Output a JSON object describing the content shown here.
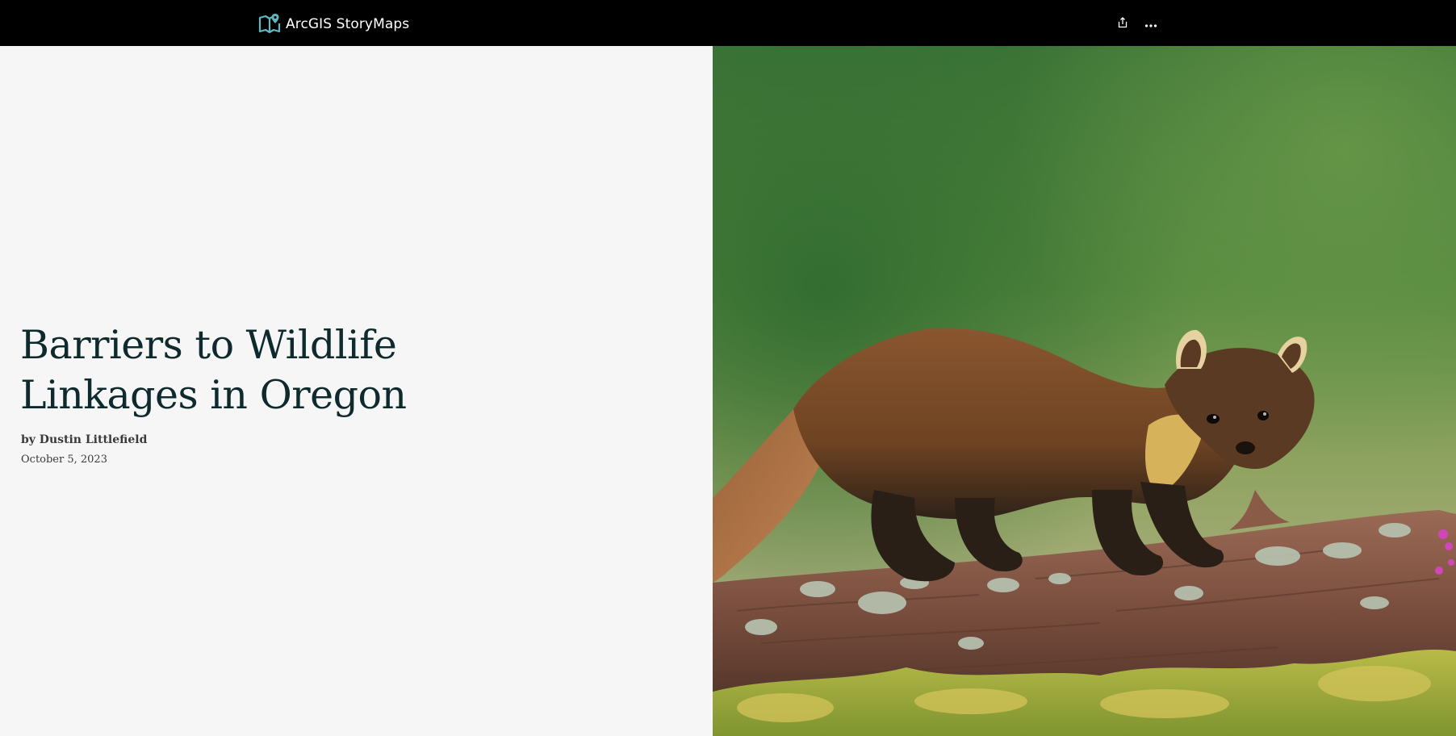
{
  "header": {
    "brand_label": "ArcGIS StoryMaps",
    "brand_icon": "storymaps-logo-icon",
    "share_icon": "share-icon",
    "more_icon": "more-options-icon"
  },
  "story": {
    "title": "Barriers to Wildlife Linkages in Oregon",
    "byline": "by Dustin Littlefield",
    "date": "October 5, 2023"
  },
  "cover_media": {
    "subject": "pine marten on a mossy log",
    "colors": {
      "background_top": "#3f7a3a",
      "background_bottom": "#a7b07a",
      "fur": "#7a4a25",
      "log": "#8a5a45",
      "moss": "#a6b040"
    }
  },
  "theme": {
    "topbar_bg": "#000000",
    "page_bg": "#f6f6f6",
    "title_color": "#0f2a2c",
    "accent": "#5fb8c2"
  }
}
